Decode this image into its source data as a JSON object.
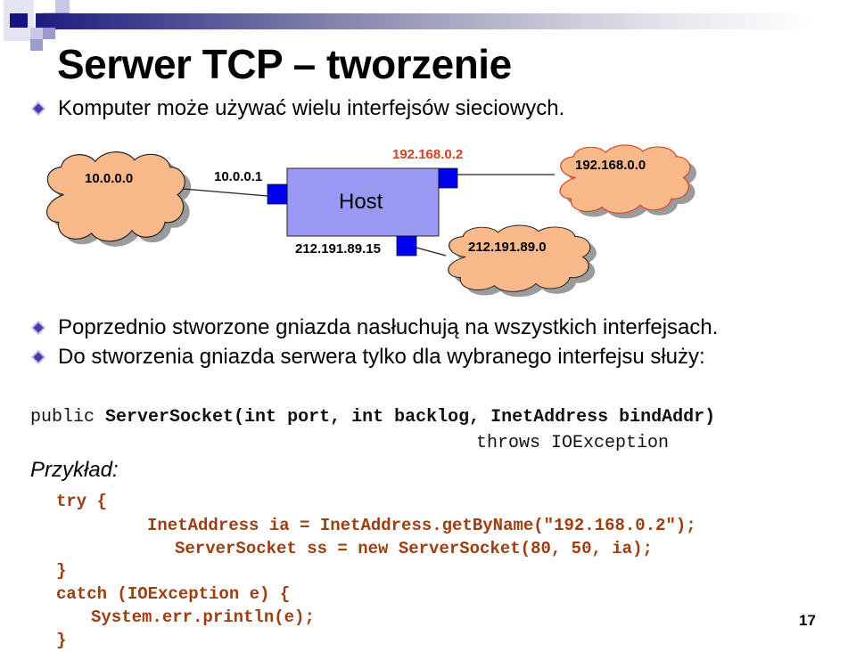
{
  "slide": {
    "title": "Serwer TCP – tworzenie",
    "page_number": "17",
    "colors": {
      "header_dark": "#1c1c80",
      "bullet": "#4b3aa8",
      "cloud_fill": "#f9b98a",
      "cloud_highlight_outline": "#d9401f",
      "host_fill": "#9999f5",
      "port_fill": "#0000f0",
      "code_text": "#9c3e12",
      "accent_label": "#d9401f"
    },
    "bullets": [
      {
        "icon": "diamond-bullet-icon",
        "text": "Komputer może używać wielu interfejsów sieciowych."
      },
      {
        "icon": "diamond-bullet-icon",
        "text": "Poprzednio stworzone gniazda nasłuchują na wszystkich interfejsach."
      },
      {
        "icon": "diamond-bullet-icon",
        "text": "Do stworzenia gniazda serwera tylko dla wybranego interfejsu służy:"
      }
    ],
    "diagram": {
      "host_label": "Host",
      "networks": [
        {
          "label": "10.0.0.0",
          "highlighted": false
        },
        {
          "label": "192.168.0.0",
          "highlighted": true
        },
        {
          "label": "212.191.89.0",
          "highlighted": false
        }
      ],
      "interfaces": [
        {
          "label": "10.0.0.1",
          "highlighted": false
        },
        {
          "label": "192.168.0.2",
          "highlighted": true
        },
        {
          "label": "212.191.89.15",
          "highlighted": false
        }
      ]
    },
    "signature": {
      "modifier": "public",
      "declaration": "ServerSocket(int port, int backlog, InetAddress bindAddr)",
      "throws_line": "throws IOException"
    },
    "example_label": "Przykład:",
    "code_lines": [
      "try {",
      "InetAddress ia = InetAddress.getByName(\"192.168.0.2\");",
      "ServerSocket ss = new ServerSocket(80, 50, ia);",
      "}",
      "catch (IOException e) {",
      "System.err.println(e);",
      "}"
    ]
  }
}
